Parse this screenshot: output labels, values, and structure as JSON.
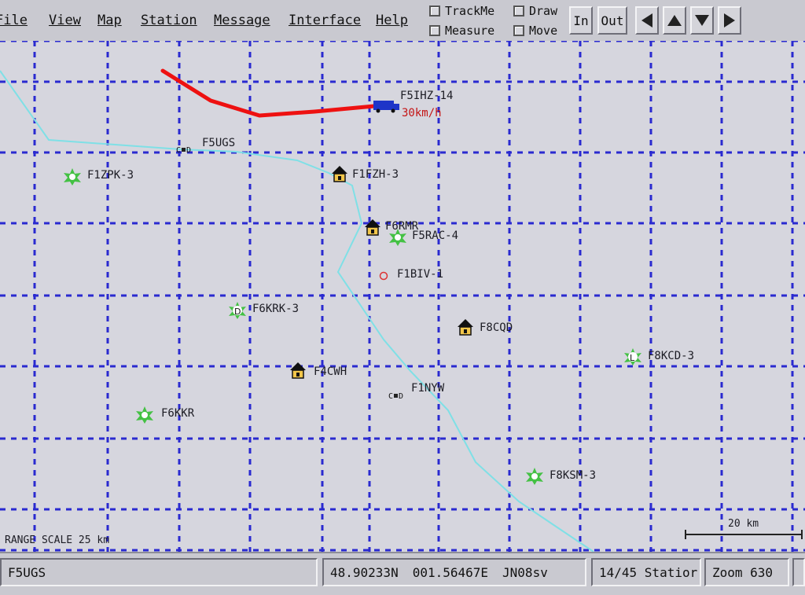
{
  "menu": {
    "file": "File",
    "view": "View",
    "map": "Map",
    "station": "Station",
    "message": "Message",
    "interface": "Interface",
    "help": "Help"
  },
  "toolbar": {
    "trackme": "TrackMe",
    "draw": "Draw",
    "measure": "Measure",
    "move": "Move",
    "zoom_in": "In",
    "zoom_out": "Out"
  },
  "map": {
    "stations": {
      "f5ihz_14": "F5IHZ-14",
      "f5ihz_speed": "30km/h",
      "f5ugs": "F5UGS",
      "f1zpk_3": "F1ZPK-3",
      "f1fzh_3": "F1FZH-3",
      "f6rmr": "F6RMR",
      "f5rac_4": "F5RAC-4",
      "f1biv_1": "F1BIV-1",
      "f6krk_3": "F6KRK-3",
      "f8cqd": "F8CQD",
      "f8kcd_3": "F8KCD-3",
      "f4cwh": "F4CWH",
      "f1nyw": "F1NYW",
      "f6kkr": "F6KKR",
      "f8ksm_3": "F8KSM-3"
    },
    "range_scale": "RANGE SCALE 25 km",
    "scale_bar": "20 km",
    "colors": {
      "track": "#ee1111",
      "route": "#7fe0e6",
      "grid": "#2a2ad0",
      "house": "#f2c64a",
      "digi": "#44c144"
    }
  },
  "status": {
    "callsign": "F5UGS",
    "lat": "48.90233N",
    "lon": "001.56467E",
    "grid": "JN08sv",
    "stations": "14/45 Statior",
    "zoom": "Zoom 630"
  }
}
